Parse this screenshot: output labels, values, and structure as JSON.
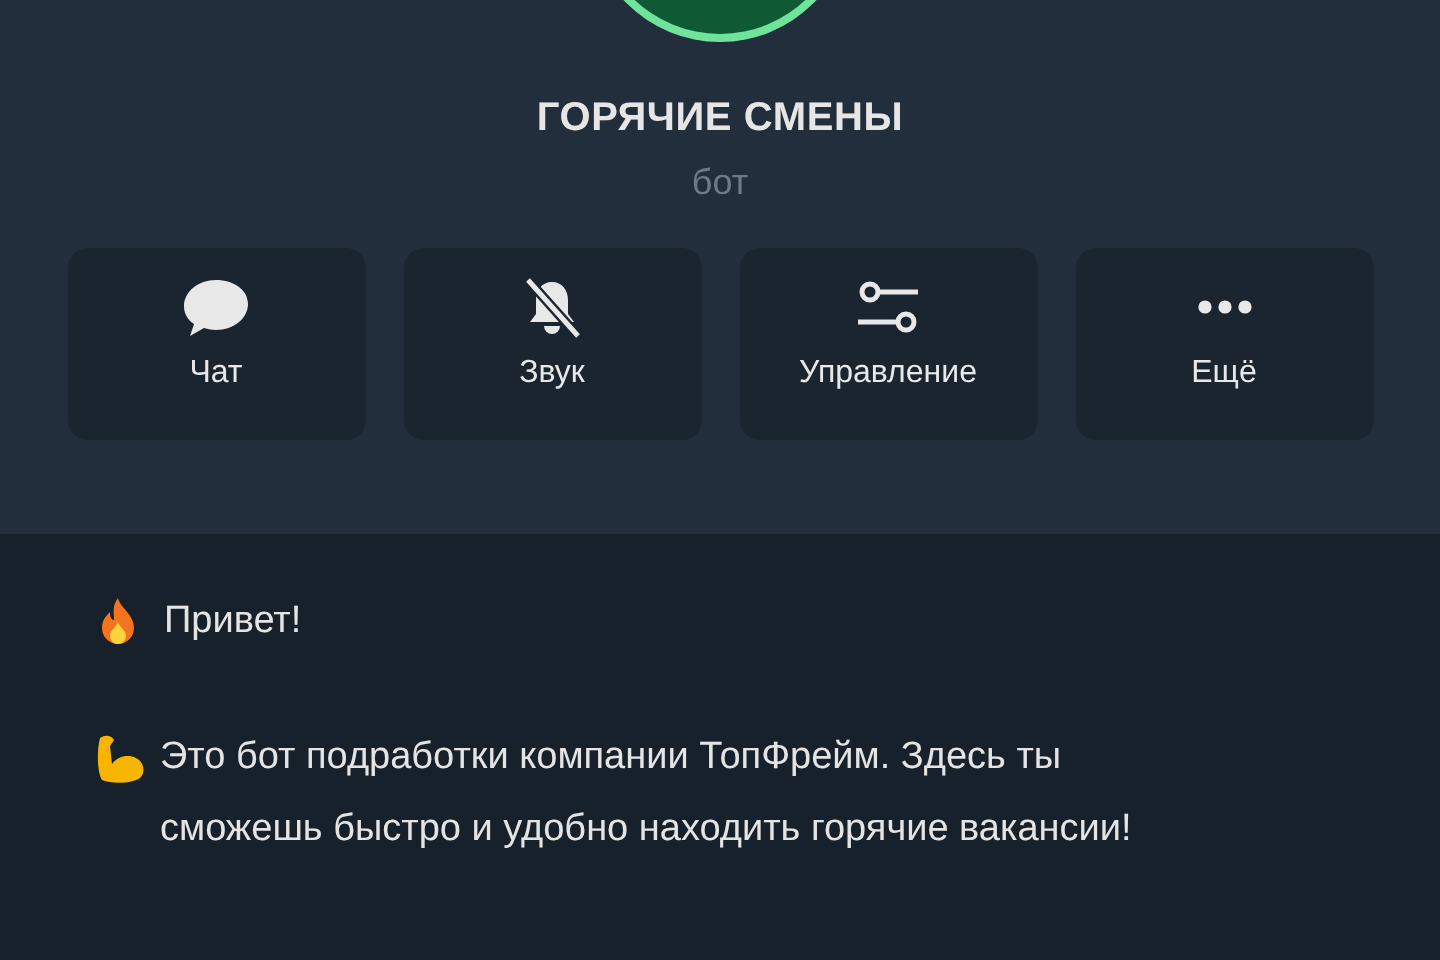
{
  "profile": {
    "name": "ГОРЯЧИЕ СМЕНЫ",
    "status": "бот"
  },
  "actions": [
    {
      "kind": "chat",
      "label": "Чат"
    },
    {
      "kind": "mute",
      "label": "Звук"
    },
    {
      "kind": "manage",
      "label": "Управление"
    },
    {
      "kind": "more",
      "label": "Ещё"
    }
  ],
  "description": [
    {
      "kind": "fire",
      "text": "Привет!"
    },
    {
      "kind": "muscle",
      "text": "Это бот подработки компании ТопФрейм. Здесь ты сможешь быстро и удобно находить горячие вакансии!"
    }
  ]
}
